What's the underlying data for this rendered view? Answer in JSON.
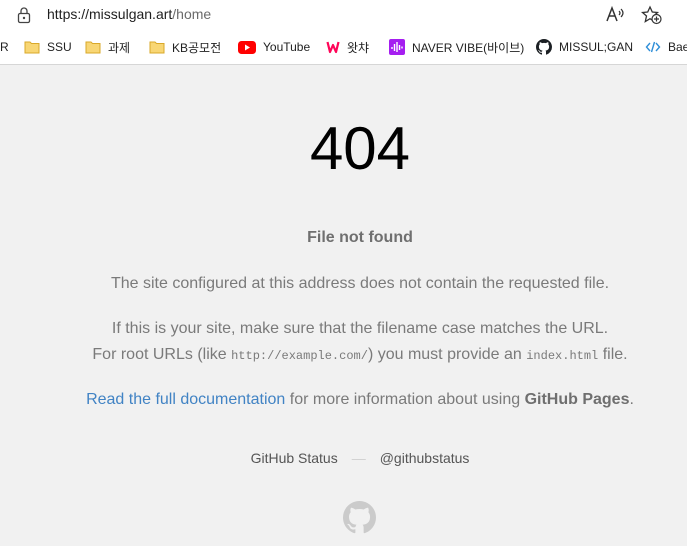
{
  "address_bar": {
    "url_host": "https://missulgan.art",
    "url_path": "/home"
  },
  "bookmarks": [
    {
      "label": "R",
      "icon": "none"
    },
    {
      "label": "SSU",
      "icon": "folder-icon"
    },
    {
      "label": "과제",
      "icon": "folder-icon"
    },
    {
      "label": "KB공모전",
      "icon": "folder-icon"
    },
    {
      "label": "YouTube",
      "icon": "youtube-icon"
    },
    {
      "label": "왓챠",
      "icon": "watcha-icon"
    },
    {
      "label": "NAVER VIBE(바이브)",
      "icon": "vibe-icon"
    },
    {
      "label": "MISSUL;GAN",
      "icon": "github-icon"
    },
    {
      "label": "Bae",
      "icon": "code-icon"
    }
  ],
  "page": {
    "code": "404",
    "heading": "File not found",
    "line1": "The site configured at this address does not contain the requested file.",
    "line2": "If this is your site, make sure that the filename case matches the URL.",
    "line3_a": "For root URLs (like ",
    "line3_code1": "http://example.com/",
    "line3_b": ") you must provide an ",
    "line3_code2": "index.html",
    "line3_c": " file.",
    "line4_link": "Read the full documentation",
    "line4_a": " for more information about using ",
    "line4_strong": "GitHub Pages",
    "line4_b": ".",
    "footer_status": "GitHub Status",
    "footer_sep": "—",
    "footer_twitter": "@githubstatus"
  },
  "colors": {
    "link": "#4183c4",
    "text": "#7a7a7a",
    "background": "#f1f1f1"
  }
}
